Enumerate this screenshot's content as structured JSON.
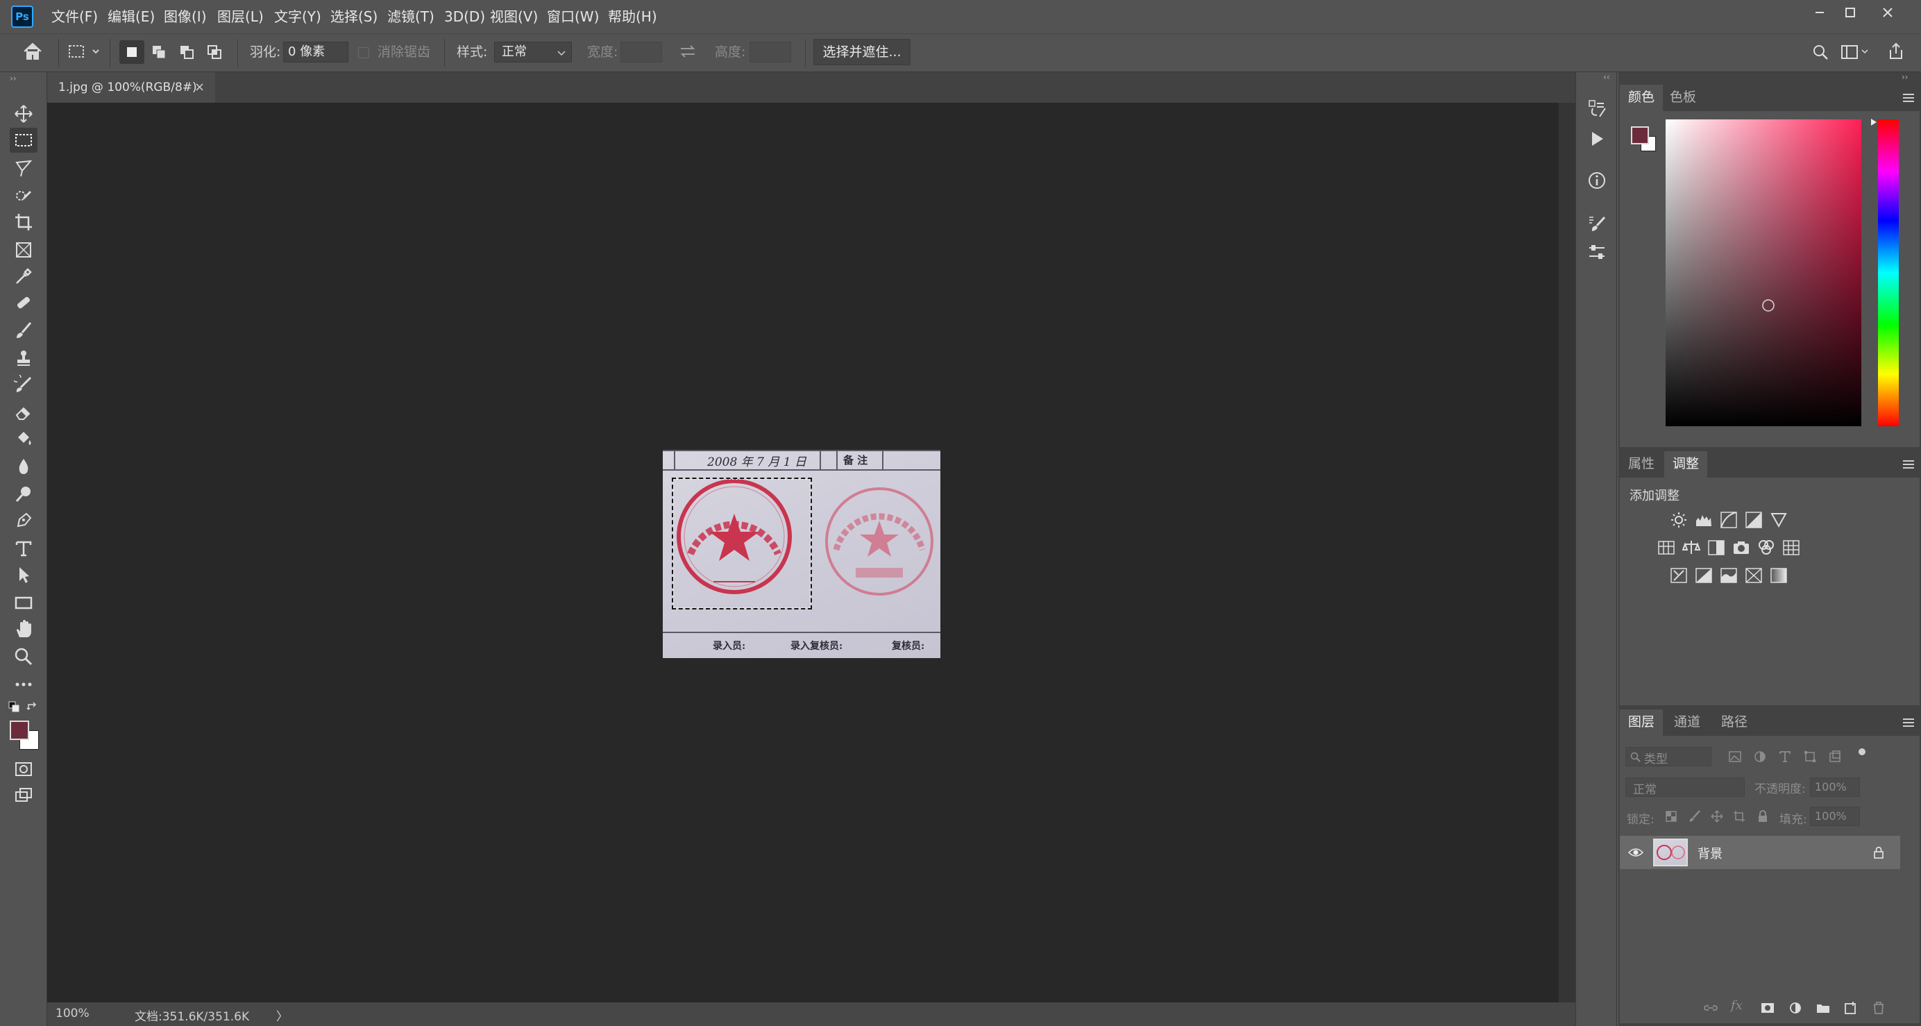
{
  "app": {
    "logo": "Ps"
  },
  "menu": [
    "文件(F)",
    "编辑(E)",
    "图像(I)",
    "图层(L)",
    "文字(Y)",
    "选择(S)",
    "滤镜(T)",
    "3D(D)",
    "视图(V)",
    "窗口(W)",
    "帮助(H)"
  ],
  "window_controls": {
    "minimize": "—",
    "maximize": "☐",
    "close": "✕"
  },
  "options": {
    "feather_label": "羽化:",
    "feather_value": "0 像素",
    "antialias_label": "消除锯齿",
    "style_label": "样式:",
    "style_value": "正常",
    "width_label": "宽度:",
    "height_label": "高度:",
    "select_mask_button": "选择并遮住..."
  },
  "document": {
    "tab_title": "1.jpg @ 100%(RGB/8#)",
    "tab_close": "×",
    "zoom": "100%",
    "doc_size": "文档:351.6K/351.6K",
    "status_arrow": "〉"
  },
  "image_content": {
    "date_text": "2008 年  7  月  1  日",
    "remark": "备 注",
    "footer": [
      "录入员:",
      "录入复核员:",
      "复核员:"
    ]
  },
  "panels": {
    "color_tabs": [
      "颜色",
      "色板"
    ],
    "adjust_tabs": [
      "属性",
      "调整"
    ],
    "add_adjustment": "添加调整",
    "layers_tabs": [
      "图层",
      "通道",
      "路径"
    ],
    "layers_filter_placeholder": "类型",
    "blend_mode": "正常",
    "opacity_label": "不透明度:",
    "opacity_value": "100%",
    "lock_label": "锁定:",
    "fill_label": "填充:",
    "fill_value": "100%",
    "layer_name": "背景"
  },
  "colors": {
    "foreground": "#6b2b3a",
    "background": "#ffffff",
    "picker_hue": "#ff1f55",
    "stamp_red": "#c9344f",
    "accent": "#31a8ff"
  },
  "icons": [
    "home-icon",
    "marquee-icon",
    "move-icon",
    "lasso-icon",
    "quick-select-icon",
    "crop-icon",
    "frame-icon",
    "eyedropper-icon",
    "healing-icon",
    "brush-icon",
    "stamp-icon",
    "history-brush-icon",
    "eraser-icon",
    "paint-bucket-icon",
    "blur-icon",
    "dodge-icon",
    "pen-icon",
    "type-icon",
    "path-select-icon",
    "rectangle-icon",
    "hand-icon",
    "zoom-icon",
    "more-icon",
    "search-icon",
    "workspace-icon",
    "share-icon",
    "eye-icon",
    "lock-icon"
  ]
}
